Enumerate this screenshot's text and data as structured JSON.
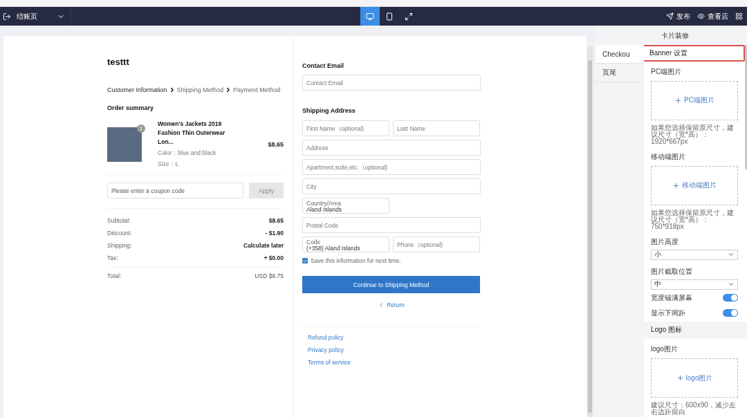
{
  "toolbar": {
    "page_select": "结账页",
    "devices": [
      {
        "kind": "desktop",
        "selected": true
      },
      {
        "kind": "mobile",
        "selected": false
      },
      {
        "kind": "resize",
        "selected": false
      }
    ],
    "actions": [
      {
        "kind": "publish",
        "label": "发布"
      },
      {
        "kind": "view",
        "label": "查看店"
      },
      {
        "kind": "grid"
      }
    ]
  },
  "checkout": {
    "store_name": "testtt",
    "breadcrumb": [
      {
        "label": "Customer Information",
        "selected": true
      },
      {
        "label": "Shipping Method",
        "selected": false
      },
      {
        "label": "Payment Method",
        "selected": false
      }
    ],
    "order_summary_title": "Order summary",
    "product": {
      "quantity": "1",
      "title": "Women's Jackets 2019 Fashion Thin Outerwear Lon...",
      "variant": "Color：blue and black",
      "size": "Size：L",
      "price": "$8.65"
    },
    "coupon": {
      "placeholder": "Please enter a coupon code",
      "button": "Apply"
    },
    "totals": [
      {
        "label": "Subtotal:",
        "value": "$8.65"
      },
      {
        "label": "Discount:",
        "value": "- $1.90"
      },
      {
        "label": "Shipping:",
        "value": "Calculate later"
      },
      {
        "label": "Tax:",
        "value": "+ $0.00"
      }
    ],
    "total": {
      "label": "Total:",
      "value": "USD $6.75"
    }
  },
  "form": {
    "contact_title": "Contact Email",
    "contact_placeholder": "Contact Email",
    "shipping_title": "Shipping Address",
    "rows": [
      [
        {
          "kind": "input",
          "placeholder": "First Name（optional)"
        },
        {
          "kind": "input",
          "placeholder": "Last Name"
        }
      ],
      [
        {
          "kind": "input",
          "placeholder": "Address"
        }
      ],
      [
        {
          "kind": "input",
          "placeholder": "Apartment,suite,etc.（optional)"
        }
      ],
      [
        {
          "kind": "input",
          "placeholder": "City"
        }
      ],
      [
        {
          "kind": "select",
          "label": "Country/Area",
          "value": "Aland Islands"
        }
      ],
      [
        {
          "kind": "input",
          "placeholder": "Postal Code"
        }
      ],
      [
        {
          "kind": "select",
          "label": "Code",
          "value": "(+358) Aland Islands"
        },
        {
          "kind": "input",
          "placeholder": "Phone（optional)"
        }
      ]
    ],
    "save": {
      "label": "Save this information for next time.",
      "checked": true
    },
    "continue_button": "Continue to Shipping Method",
    "return_link": "Return",
    "policies": [
      "Refund policy",
      "Privacy policy",
      "Terms of service"
    ]
  },
  "panel": {
    "title": "卡片装修",
    "tabs": [
      {
        "label": "Checkou",
        "selected": true
      },
      {
        "label": "页尾",
        "selected": false
      }
    ],
    "items": [
      {
        "kind": "header",
        "label": "Banner 设置",
        "highlighted": true
      },
      {
        "kind": "upload",
        "label": "PC端图片",
        "button": "PC端图片",
        "hint": "如果您选择保留原尺寸，建议尺寸（宽*高）：1920*667px"
      },
      {
        "kind": "upload",
        "label": "移动端图片",
        "button": "移动端图片",
        "hint": "如果您选择保留原尺寸，建议尺寸（宽*高）：750*918px"
      },
      {
        "kind": "select",
        "label": "图片高度",
        "value": "小"
      },
      {
        "kind": "select",
        "label": "图片截取位置",
        "value": "中"
      },
      {
        "kind": "toggle",
        "label": "宽度铺满屏幕",
        "on": true
      },
      {
        "kind": "toggle",
        "label": "显示下间距",
        "on": true
      },
      {
        "kind": "header",
        "label": "Logo 图标",
        "highlighted": false
      },
      {
        "kind": "upload",
        "label": "logo图片",
        "button": "logo图片",
        "hint": "建议尺寸：600x90，减少左右边距留白"
      }
    ]
  }
}
